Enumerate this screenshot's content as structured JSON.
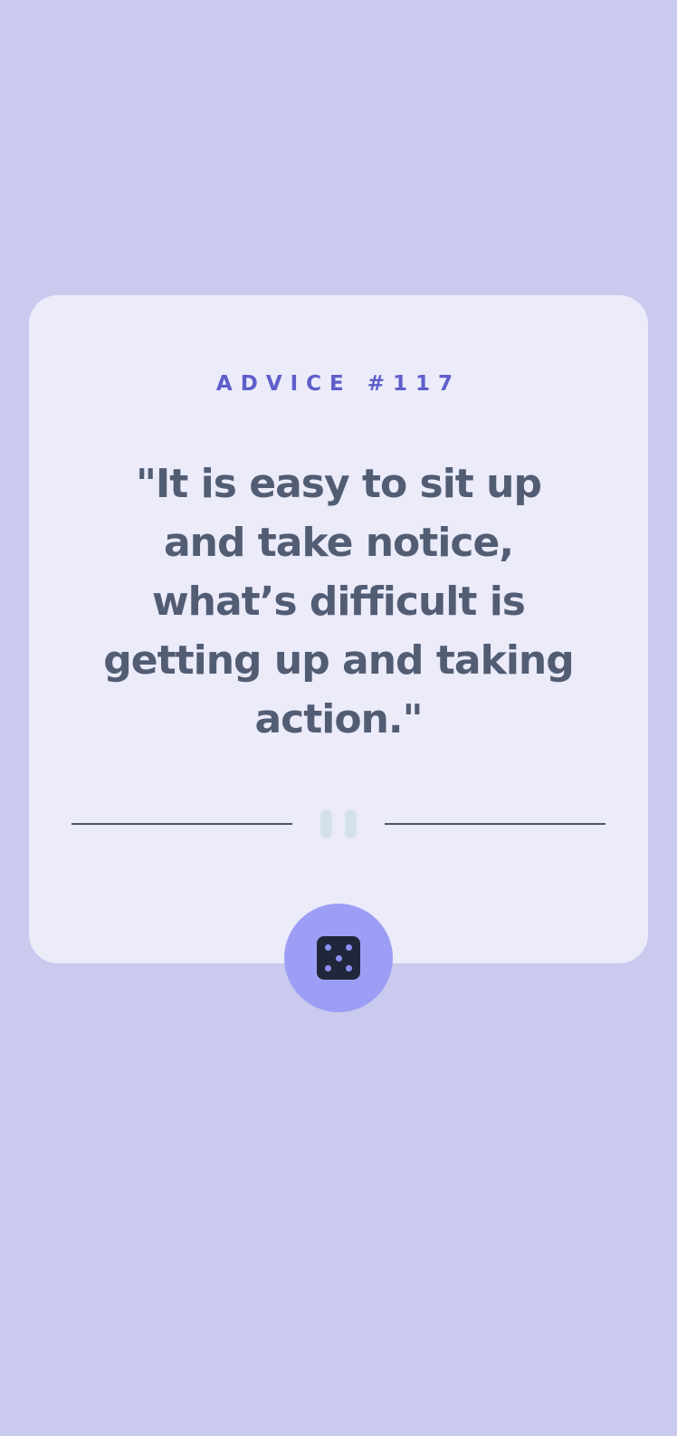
{
  "advice": {
    "id_label": "ADVICE #117",
    "text": "\"It is easy to sit up and take notice, what’s difficult is getting up and taking action.\""
  },
  "divider": {
    "icon": "pause-icon"
  },
  "dice_button": {
    "icon": "dice-icon",
    "pips": 5
  },
  "colors": {
    "background": "#cac9ee",
    "card": "#ebebfa",
    "accent": "#5e5ecb",
    "text": "#525d74",
    "button": "#9c9ef6",
    "dice": "#21273a"
  }
}
